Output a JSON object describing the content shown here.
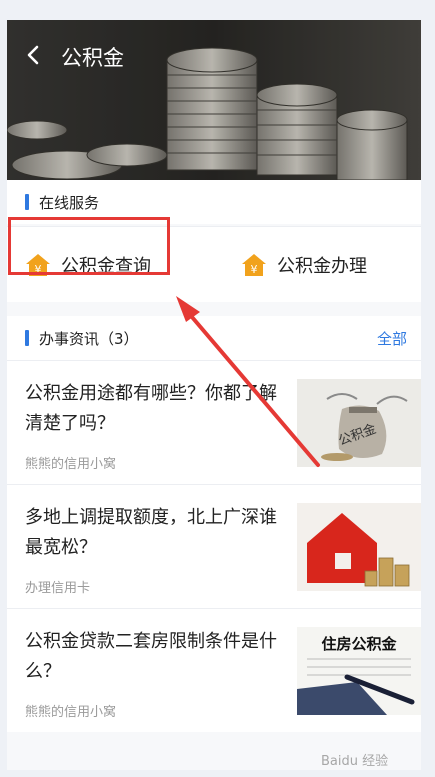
{
  "header": {
    "title": "公积金"
  },
  "online_services": {
    "title": "在线服务",
    "items": [
      {
        "label": "公积金查询",
        "icon": "yuan-house-icon"
      },
      {
        "label": "公积金办理",
        "icon": "yuan-house-icon"
      }
    ]
  },
  "news_section": {
    "title": "办事资讯（3）",
    "more_label": "全部",
    "items": [
      {
        "title": "公积金用途都有哪些？你都了解清楚了吗？",
        "source": "熊熊的信用小窝",
        "thumb": "money-bag-image",
        "thumb_text": "公积金"
      },
      {
        "title": "多地上调提取额度，北上广深谁最宽松？",
        "source": "办理信用卡",
        "thumb": "red-house-coins-image"
      },
      {
        "title": "公积金贷款二套房限制条件是什么？",
        "source": "熊熊的信用小窝",
        "thumb": "housing-fund-document-image",
        "thumb_text": "住房公积金"
      }
    ]
  },
  "watermark": "Baidu 经验",
  "colors": {
    "accent": "#2f79e0",
    "highlight": "#e53935",
    "icon": "#f1a21c"
  }
}
